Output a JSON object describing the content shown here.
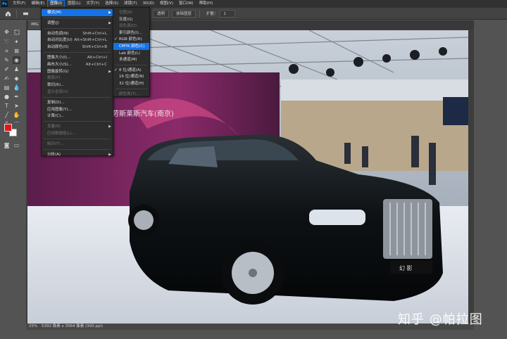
{
  "menubar": {
    "logo": "Ps",
    "items": [
      {
        "label": "文件(F)"
      },
      {
        "label": "编辑(E)"
      },
      {
        "label": "图像(I)",
        "active": true
      },
      {
        "label": "图层(L)"
      },
      {
        "label": "文字(Y)"
      },
      {
        "label": "选择(S)"
      },
      {
        "label": "滤镜(T)"
      },
      {
        "label": "3D(D)"
      },
      {
        "label": "视图(V)"
      },
      {
        "label": "窗口(W)"
      },
      {
        "label": "帮助(H)"
      }
    ]
  },
  "options_bar": {
    "button_label": "透明",
    "button2_label": "抹除图层",
    "zoom_label": "扩散：",
    "zoom_value": "1"
  },
  "document": {
    "tab_label": "IMG",
    "image_sign": "劳斯莱斯汽车(南京)",
    "plate_text": "幻 影"
  },
  "status": {
    "zoom": "25%",
    "dimensions": "5392 像素 x 3564 像素 (300 ppi)"
  },
  "watermark": "知乎 @帕拉图",
  "image_menu": {
    "items": [
      {
        "label": "模式(M)",
        "submenu": true,
        "highlight": true
      },
      {
        "sep": true
      },
      {
        "label": "调整(J)",
        "submenu": true
      },
      {
        "sep": true
      },
      {
        "label": "自动色调(N)",
        "shortcut": "Shift+Ctrl+L"
      },
      {
        "label": "自动对比度(U)",
        "shortcut": "Alt+Shift+Ctrl+L"
      },
      {
        "label": "自动颜色(O)",
        "shortcut": "Shift+Ctrl+B"
      },
      {
        "sep": true
      },
      {
        "label": "图像大小(I)...",
        "shortcut": "Alt+Ctrl+I"
      },
      {
        "label": "画布大小(S)...",
        "shortcut": "Alt+Ctrl+C"
      },
      {
        "label": "图像旋转(G)",
        "submenu": true
      },
      {
        "label": "裁剪(P)",
        "disabled": true
      },
      {
        "label": "裁切(R)..."
      },
      {
        "label": "显示全部(V)",
        "disabled": true
      },
      {
        "sep": true
      },
      {
        "label": "复制(D)..."
      },
      {
        "label": "应用图像(Y)..."
      },
      {
        "label": "计算(C)..."
      },
      {
        "sep": true
      },
      {
        "label": "变量(B)",
        "submenu": true,
        "disabled": true
      },
      {
        "label": "应用数据组(L)...",
        "disabled": true
      },
      {
        "sep": true
      },
      {
        "label": "陷印(T)...",
        "disabled": true
      },
      {
        "sep": true
      },
      {
        "label": "分析(A)",
        "submenu": true
      }
    ]
  },
  "mode_submenu": {
    "items": [
      {
        "label": "位图(B)",
        "disabled": true
      },
      {
        "label": "灰度(G)"
      },
      {
        "label": "双色调(D)",
        "disabled": true
      },
      {
        "label": "索引颜色(I)..."
      },
      {
        "label": "RGB 颜色(R)",
        "checked": true
      },
      {
        "label": "CMYK 颜色(C)",
        "highlight": true
      },
      {
        "label": "Lab 颜色(L)"
      },
      {
        "label": "多通道(M)"
      },
      {
        "sep": true
      },
      {
        "label": "8 位/通道(A)",
        "checked": true
      },
      {
        "label": "16 位/通道(N)"
      },
      {
        "label": "32 位/通道(H)"
      },
      {
        "sep": true
      },
      {
        "label": "颜色表(T)...",
        "disabled": true
      }
    ]
  },
  "colors": {
    "foreground": "#e8141c",
    "background": "#ffffff",
    "highlight": "#1473e6"
  }
}
